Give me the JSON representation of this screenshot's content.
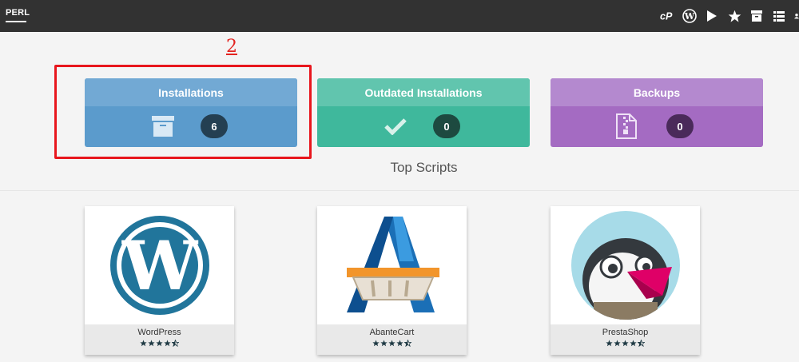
{
  "topbar": {
    "menu_label": "PERL",
    "icons": [
      "cpanel-icon",
      "wordpress-icon",
      "play-icon",
      "star-icon",
      "archive-icon",
      "list-icon"
    ]
  },
  "annotation": {
    "number": "2",
    "color": "#e8161d"
  },
  "stats": [
    {
      "title": "Installations",
      "count": "6",
      "icon": "archive-box-icon",
      "color": "#5b9bcc"
    },
    {
      "title": "Outdated Installations",
      "count": "0",
      "icon": "checkmark-icon",
      "color": "#3fb89c"
    },
    {
      "title": "Backups",
      "count": "0",
      "icon": "zip-file-icon",
      "color": "#a46bc2"
    }
  ],
  "top_scripts": {
    "title": "Top Scripts",
    "items": [
      {
        "name": "WordPress",
        "rating": 4.5
      },
      {
        "name": "AbanteCart",
        "rating": 4.5
      },
      {
        "name": "PrestaShop",
        "rating": 4.5
      }
    ]
  }
}
